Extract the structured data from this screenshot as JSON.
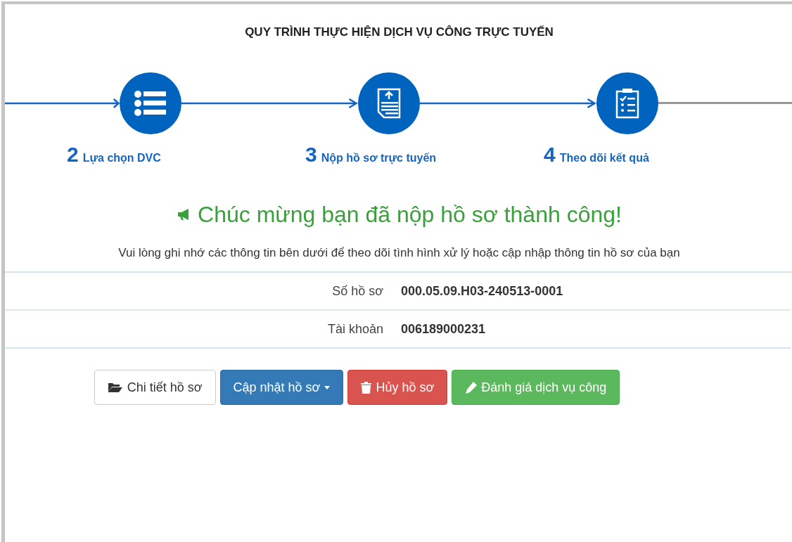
{
  "title": "QUY TRÌNH THỰC HIỆN DỊCH VỤ CÔNG TRỰC TUYẾN",
  "steps": [
    {
      "number": "2",
      "label": "Lựa chọn DVC",
      "kind": "list",
      "incoming_done": true
    },
    {
      "number": "3",
      "label": "Nộp hồ sơ trực tuyến",
      "kind": "upload",
      "incoming_done": true
    },
    {
      "number": "4",
      "label": "Theo dõi kết quả",
      "kind": "clipboard",
      "incoming_done": true
    }
  ],
  "trailing_line_done": false,
  "success_message": "Chúc mừng bạn đã nộp hồ sơ thành công!",
  "instruction": "Vui lòng ghi nhớ các thông tin bên dưới để theo dõi tình hình xử lý hoặc cập nhập thông tin hồ sơ của bạn",
  "info_rows": [
    {
      "label": "Số hồ sơ",
      "value": "000.05.09.H03-240513-0001"
    },
    {
      "label": "Tài khoản",
      "value": "006189000231"
    }
  ],
  "buttons": [
    {
      "label": "Chi tiết hồ sơ",
      "kind": "default",
      "dropdown": false
    },
    {
      "label": "Cập nhật hồ sơ",
      "kind": "primary",
      "dropdown": true
    },
    {
      "label": "Hủy hồ sơ",
      "kind": "danger",
      "dropdown": false
    },
    {
      "label": "Đánh giá dịch vụ công",
      "kind": "success",
      "dropdown": false
    }
  ]
}
